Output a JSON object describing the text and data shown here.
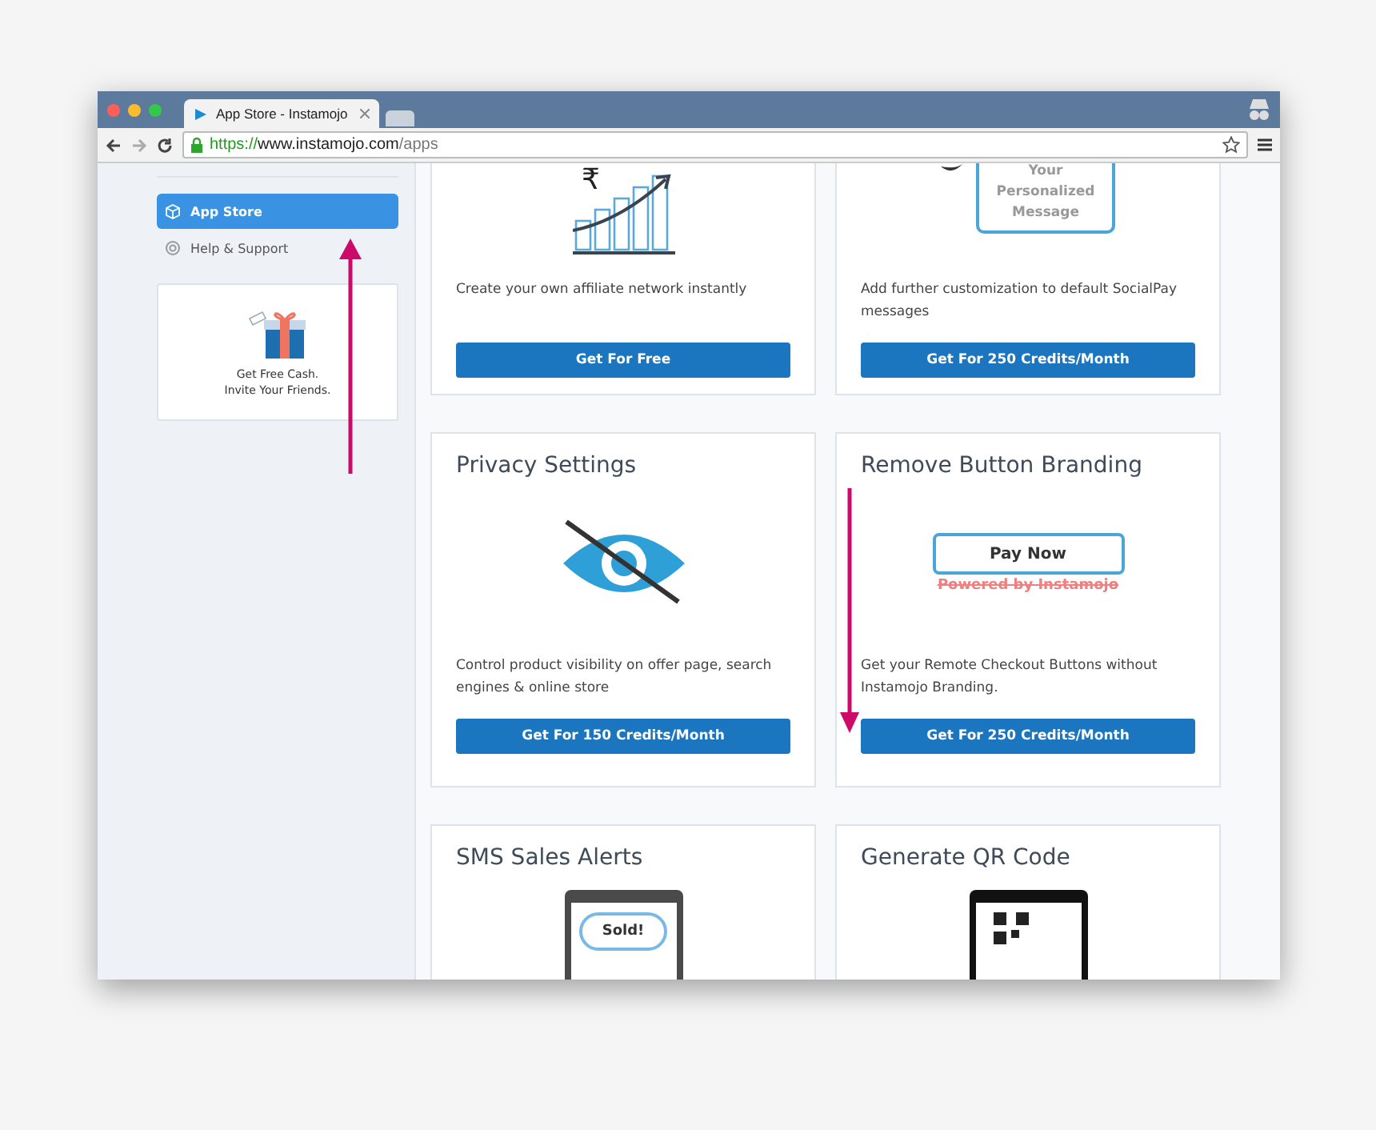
{
  "browser": {
    "tab_title": "App Store - Instamojo",
    "url": {
      "scheme": "https://",
      "host": "www.instamojo.com",
      "path": "/apps"
    }
  },
  "sidebar": {
    "items": [
      {
        "label": "App Store",
        "selected": true
      },
      {
        "label": "Help & Support",
        "selected": false
      }
    ],
    "promo": {
      "lines": [
        "Get Free Cash.",
        "Invite Your Friends."
      ]
    }
  },
  "cards": [
    {
      "illustration": {
        "kind": "growth-chart",
        "texts": [
          "₹"
        ]
      },
      "description": "Create your own affiliate network instantly",
      "button": "Get For Free"
    },
    {
      "illustration": {
        "kind": "message",
        "texts": [
          "Your",
          "Personalized",
          "Message"
        ]
      },
      "description": "Add further customization to default SocialPay messages",
      "button": "Get For 250 Credits/Month"
    },
    {
      "title": "Privacy Settings",
      "illustration": {
        "kind": "privacy-eye"
      },
      "description": "Control product visibility on offer page, search engines & online store",
      "button": "Get For 150 Credits/Month"
    },
    {
      "title": "Remove Button Branding",
      "illustration": {
        "kind": "pay-button",
        "texts": [
          "Pay Now",
          "Powered by Instamojo"
        ]
      },
      "description": "Get your Remote Checkout Buttons without Instamojo Branding.",
      "button": "Get For 250 Credits/Month"
    },
    {
      "title": "SMS Sales Alerts",
      "illustration": {
        "kind": "sms-phone",
        "texts": [
          "Sold!"
        ]
      }
    },
    {
      "title": "Generate QR Code",
      "illustration": {
        "kind": "qr-code"
      }
    }
  ]
}
